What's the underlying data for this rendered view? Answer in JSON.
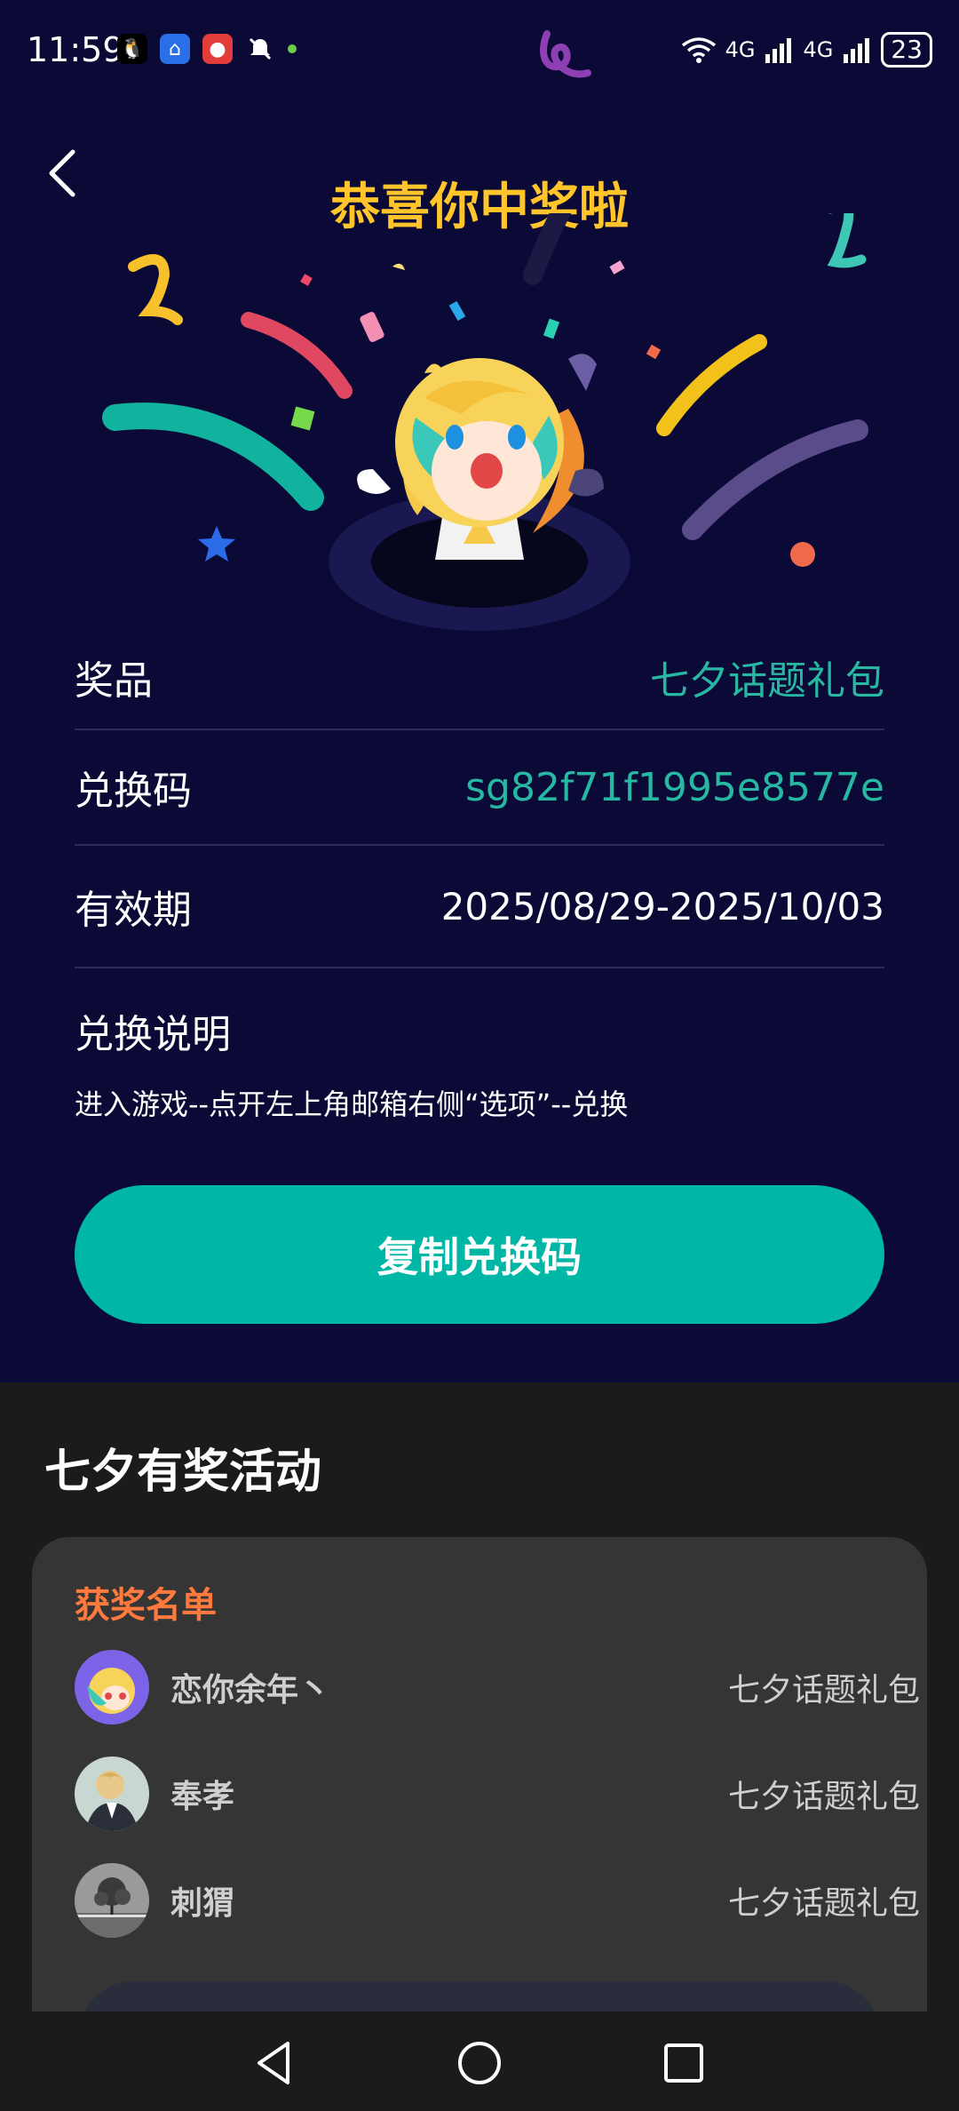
{
  "status_bar": {
    "time": "11:59",
    "battery": "23",
    "net1": "4G",
    "net2": "4G"
  },
  "header": {
    "title": "恭喜你中奖啦"
  },
  "prize_info": {
    "prize_label": "奖品",
    "prize_value": "七夕话题礼包",
    "code_label": "兑换码",
    "code_value": "sg82f71f1995e8577e",
    "validity_label": "有效期",
    "validity_value": "2025/08/29-2025/10/03",
    "instructions_title": "兑换说明",
    "instructions_text": "进入游戏--点开左上角邮箱右侧“选项”--兑换"
  },
  "actions": {
    "copy_label": "复制兑换码"
  },
  "activity": {
    "section_title": "七夕有奖活动",
    "winners_title": "获奖名单",
    "winners": [
      {
        "name": "恋你余年丶",
        "prize": "七夕话题礼包"
      },
      {
        "name": "奉孝",
        "prize": "七夕话题礼包"
      },
      {
        "name": "刺猬",
        "prize": "七夕话题礼包"
      }
    ]
  },
  "colors": {
    "background_top": "#0b0935",
    "title_gold": "#ffc52a",
    "teal_accent": "#00b6a5",
    "winners_orange": "#ff7a3c",
    "card_bg": "#353535",
    "bottom_bg": "#1b1b1c"
  }
}
